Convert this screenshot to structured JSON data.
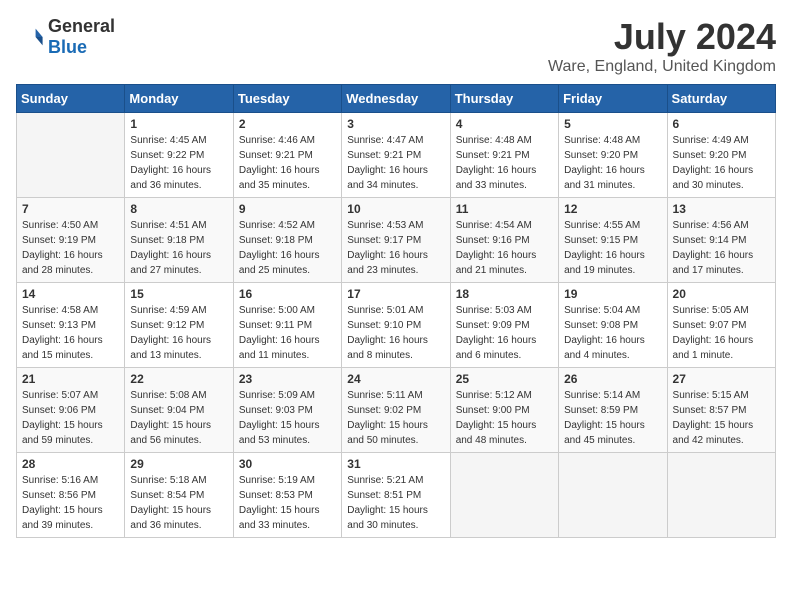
{
  "header": {
    "logo_general": "General",
    "logo_blue": "Blue",
    "month_year": "July 2024",
    "location": "Ware, England, United Kingdom"
  },
  "days_of_week": [
    "Sunday",
    "Monday",
    "Tuesday",
    "Wednesday",
    "Thursday",
    "Friday",
    "Saturday"
  ],
  "weeks": [
    [
      {
        "day": "",
        "sunrise": "",
        "sunset": "",
        "daylight": ""
      },
      {
        "day": "1",
        "sunrise": "Sunrise: 4:45 AM",
        "sunset": "Sunset: 9:22 PM",
        "daylight": "Daylight: 16 hours and 36 minutes."
      },
      {
        "day": "2",
        "sunrise": "Sunrise: 4:46 AM",
        "sunset": "Sunset: 9:21 PM",
        "daylight": "Daylight: 16 hours and 35 minutes."
      },
      {
        "day": "3",
        "sunrise": "Sunrise: 4:47 AM",
        "sunset": "Sunset: 9:21 PM",
        "daylight": "Daylight: 16 hours and 34 minutes."
      },
      {
        "day": "4",
        "sunrise": "Sunrise: 4:48 AM",
        "sunset": "Sunset: 9:21 PM",
        "daylight": "Daylight: 16 hours and 33 minutes."
      },
      {
        "day": "5",
        "sunrise": "Sunrise: 4:48 AM",
        "sunset": "Sunset: 9:20 PM",
        "daylight": "Daylight: 16 hours and 31 minutes."
      },
      {
        "day": "6",
        "sunrise": "Sunrise: 4:49 AM",
        "sunset": "Sunset: 9:20 PM",
        "daylight": "Daylight: 16 hours and 30 minutes."
      }
    ],
    [
      {
        "day": "7",
        "sunrise": "Sunrise: 4:50 AM",
        "sunset": "Sunset: 9:19 PM",
        "daylight": "Daylight: 16 hours and 28 minutes."
      },
      {
        "day": "8",
        "sunrise": "Sunrise: 4:51 AM",
        "sunset": "Sunset: 9:18 PM",
        "daylight": "Daylight: 16 hours and 27 minutes."
      },
      {
        "day": "9",
        "sunrise": "Sunrise: 4:52 AM",
        "sunset": "Sunset: 9:18 PM",
        "daylight": "Daylight: 16 hours and 25 minutes."
      },
      {
        "day": "10",
        "sunrise": "Sunrise: 4:53 AM",
        "sunset": "Sunset: 9:17 PM",
        "daylight": "Daylight: 16 hours and 23 minutes."
      },
      {
        "day": "11",
        "sunrise": "Sunrise: 4:54 AM",
        "sunset": "Sunset: 9:16 PM",
        "daylight": "Daylight: 16 hours and 21 minutes."
      },
      {
        "day": "12",
        "sunrise": "Sunrise: 4:55 AM",
        "sunset": "Sunset: 9:15 PM",
        "daylight": "Daylight: 16 hours and 19 minutes."
      },
      {
        "day": "13",
        "sunrise": "Sunrise: 4:56 AM",
        "sunset": "Sunset: 9:14 PM",
        "daylight": "Daylight: 16 hours and 17 minutes."
      }
    ],
    [
      {
        "day": "14",
        "sunrise": "Sunrise: 4:58 AM",
        "sunset": "Sunset: 9:13 PM",
        "daylight": "Daylight: 16 hours and 15 minutes."
      },
      {
        "day": "15",
        "sunrise": "Sunrise: 4:59 AM",
        "sunset": "Sunset: 9:12 PM",
        "daylight": "Daylight: 16 hours and 13 minutes."
      },
      {
        "day": "16",
        "sunrise": "Sunrise: 5:00 AM",
        "sunset": "Sunset: 9:11 PM",
        "daylight": "Daylight: 16 hours and 11 minutes."
      },
      {
        "day": "17",
        "sunrise": "Sunrise: 5:01 AM",
        "sunset": "Sunset: 9:10 PM",
        "daylight": "Daylight: 16 hours and 8 minutes."
      },
      {
        "day": "18",
        "sunrise": "Sunrise: 5:03 AM",
        "sunset": "Sunset: 9:09 PM",
        "daylight": "Daylight: 16 hours and 6 minutes."
      },
      {
        "day": "19",
        "sunrise": "Sunrise: 5:04 AM",
        "sunset": "Sunset: 9:08 PM",
        "daylight": "Daylight: 16 hours and 4 minutes."
      },
      {
        "day": "20",
        "sunrise": "Sunrise: 5:05 AM",
        "sunset": "Sunset: 9:07 PM",
        "daylight": "Daylight: 16 hours and 1 minute."
      }
    ],
    [
      {
        "day": "21",
        "sunrise": "Sunrise: 5:07 AM",
        "sunset": "Sunset: 9:06 PM",
        "daylight": "Daylight: 15 hours and 59 minutes."
      },
      {
        "day": "22",
        "sunrise": "Sunrise: 5:08 AM",
        "sunset": "Sunset: 9:04 PM",
        "daylight": "Daylight: 15 hours and 56 minutes."
      },
      {
        "day": "23",
        "sunrise": "Sunrise: 5:09 AM",
        "sunset": "Sunset: 9:03 PM",
        "daylight": "Daylight: 15 hours and 53 minutes."
      },
      {
        "day": "24",
        "sunrise": "Sunrise: 5:11 AM",
        "sunset": "Sunset: 9:02 PM",
        "daylight": "Daylight: 15 hours and 50 minutes."
      },
      {
        "day": "25",
        "sunrise": "Sunrise: 5:12 AM",
        "sunset": "Sunset: 9:00 PM",
        "daylight": "Daylight: 15 hours and 48 minutes."
      },
      {
        "day": "26",
        "sunrise": "Sunrise: 5:14 AM",
        "sunset": "Sunset: 8:59 PM",
        "daylight": "Daylight: 15 hours and 45 minutes."
      },
      {
        "day": "27",
        "sunrise": "Sunrise: 5:15 AM",
        "sunset": "Sunset: 8:57 PM",
        "daylight": "Daylight: 15 hours and 42 minutes."
      }
    ],
    [
      {
        "day": "28",
        "sunrise": "Sunrise: 5:16 AM",
        "sunset": "Sunset: 8:56 PM",
        "daylight": "Daylight: 15 hours and 39 minutes."
      },
      {
        "day": "29",
        "sunrise": "Sunrise: 5:18 AM",
        "sunset": "Sunset: 8:54 PM",
        "daylight": "Daylight: 15 hours and 36 minutes."
      },
      {
        "day": "30",
        "sunrise": "Sunrise: 5:19 AM",
        "sunset": "Sunset: 8:53 PM",
        "daylight": "Daylight: 15 hours and 33 minutes."
      },
      {
        "day": "31",
        "sunrise": "Sunrise: 5:21 AM",
        "sunset": "Sunset: 8:51 PM",
        "daylight": "Daylight: 15 hours and 30 minutes."
      },
      {
        "day": "",
        "sunrise": "",
        "sunset": "",
        "daylight": ""
      },
      {
        "day": "",
        "sunrise": "",
        "sunset": "",
        "daylight": ""
      },
      {
        "day": "",
        "sunrise": "",
        "sunset": "",
        "daylight": ""
      }
    ]
  ]
}
